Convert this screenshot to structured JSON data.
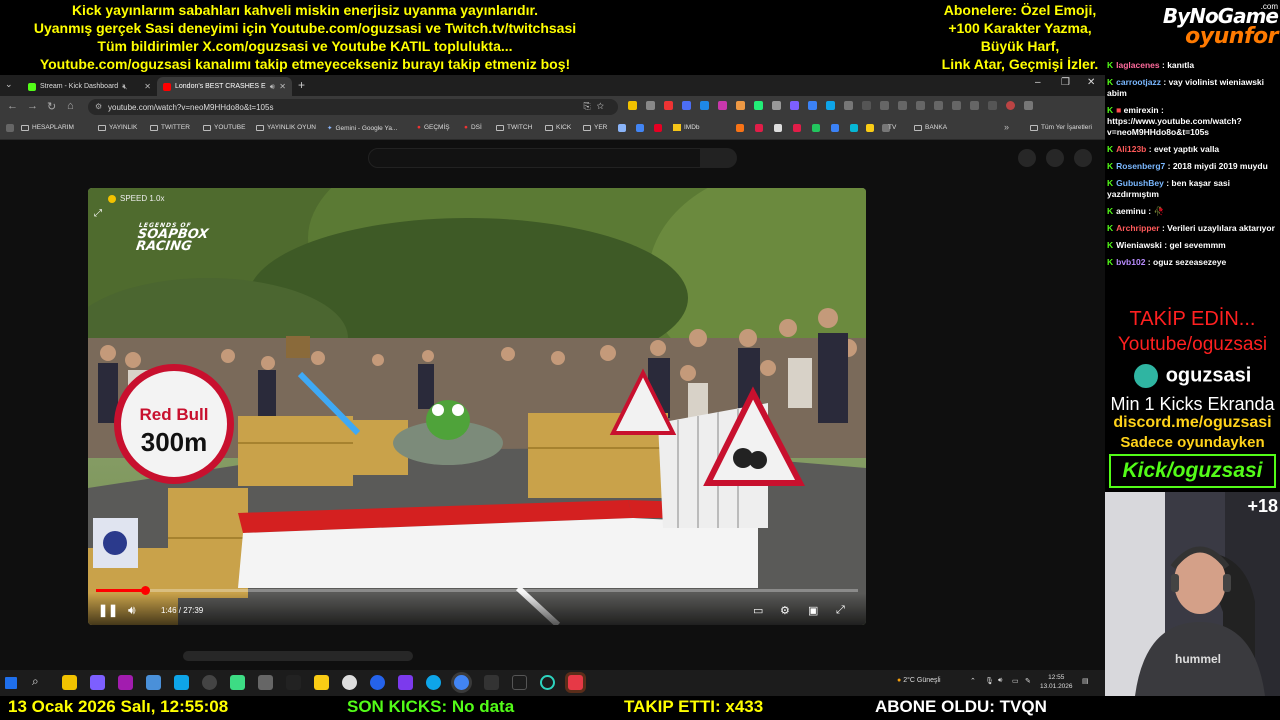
{
  "overlay": {
    "banner_lines": [
      "Kick yayınlarım sabahları kahveli miskin enerjisiz uyanma yayınlarıdır.",
      "Uyanmış gerçek Sasi deneyimi için Youtube.com/oguzsasi ve Twitch.tv/twitchsasi",
      "Tüm bildirimler X.com/oguzsasi ve Youtube KATIL toplulukta...",
      "Youtube.com/oguzsasi kanalımı takip etmeyecekseniz burayı takip etmeniz boş!"
    ],
    "subscriber_lines": [
      "Abonelere: Özel Emoji,",
      "+100 Karakter Yazma,",
      "Büyük Harf,",
      "Link Atar, Geçmişi İzler."
    ],
    "logo": {
      "line1": "ByNoGame",
      "line2": "oyunfor",
      "sup": ".com"
    }
  },
  "browser": {
    "tabs": [
      {
        "label": "Stream - Kick Dashboard",
        "color": "#53fc18"
      },
      {
        "label": "London's BEST CRASHES E",
        "color": "#ff0000"
      }
    ],
    "url": "youtube.com/watch?v=neoM9HHdo8o&t=105s",
    "bookmarks": [
      "HESAPLARIM",
      "YAYINLIK",
      "TWITTER",
      "YOUTUBE",
      "YAYINLIK OYUN",
      "Gemini - Google Ya...",
      "GEÇMİŞ",
      "DSİ",
      "TWITCH",
      "KICK",
      "YER",
      "IMDb",
      "TV",
      "BANKA",
      "Tüm Yer İşaretleri"
    ]
  },
  "video": {
    "speed": "SPEED 1.0x",
    "brand_lines": [
      "LEGENDS OF",
      "SOAPBOX",
      "RACING"
    ],
    "sign_brand": "Red Bull",
    "sign_distance": "300m",
    "time": "1:46 / 27:39",
    "progress": 0.064
  },
  "taskbar": {
    "weather": "2°C  Güneşli",
    "time": "12:55",
    "date": "13.01.2026"
  },
  "ticker": {
    "datetime": "13 Ocak 2026 Salı, 12:55:08",
    "kicks": "SON KICKS: No data",
    "follows": "TAKIP ETTI: x433",
    "subscribed": "ABONE OLDU: TVQN"
  },
  "chat": [
    {
      "user": "laglacenes",
      "color": "#ff6b9d",
      "text": "kanıtla"
    },
    {
      "user": "carrootjazz",
      "color": "#7ab8ff",
      "text": "vay violinist wieniawski abim"
    },
    {
      "user": "emirexin",
      "color": "#ffffff",
      "text": "https://www.youtube.com/watch?v=neoM9HHdo8o&t=105s"
    },
    {
      "user": "Ali123b",
      "color": "#ff5a5a",
      "text": "evet yaptık valla"
    },
    {
      "user": "Rosenberg7",
      "color": "#7ab8ff",
      "text": "2018 miydi 2019 muydu"
    },
    {
      "user": "GubushBey",
      "color": "#7ab8ff",
      "text": "ben kaşar sasi yazdırmıştım"
    },
    {
      "user": "aeminu",
      "color": "#ffffff",
      "text": "🥀"
    },
    {
      "user": "Archripper",
      "color": "#ff5a5a",
      "text": "Verileri uzaylılara aktarıyor"
    },
    {
      "user": "Wieniawski",
      "color": "#ffffff",
      "text": "gel sevemmm"
    },
    {
      "user": "bvb102",
      "color": "#b98cff",
      "text": "oguz sezeasezeye"
    }
  ],
  "promo": {
    "follow": "TAKİP EDİN...",
    "youtube": "Youtube/oguzsasi",
    "discord_name": "oguzsasi",
    "kicks_min": "Min 1 Kicks Ekranda",
    "discord_url": "discord.me/oguzsasi",
    "only_game": "Sadece oyundayken",
    "kick": "Kick/oguzsasi"
  },
  "webcam": {
    "badge": "+18",
    "shirt": "hummel"
  }
}
